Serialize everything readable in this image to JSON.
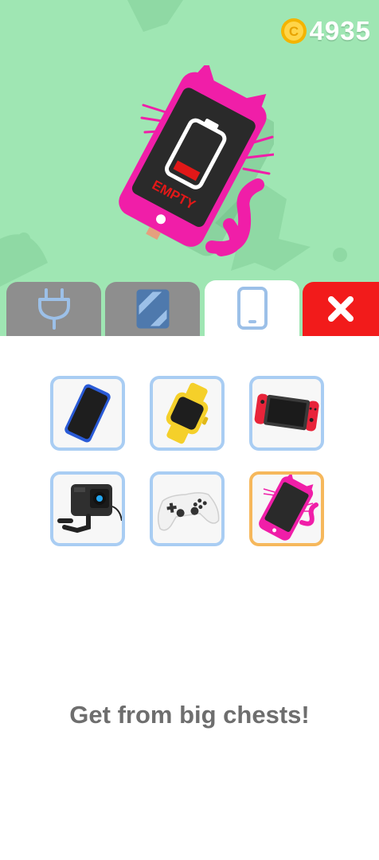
{
  "currency": {
    "amount": "4935",
    "icon": "coin-icon"
  },
  "preview": {
    "device": "cat-phone-case",
    "screen_label": "EMPTY"
  },
  "tabs": [
    {
      "name": "plug",
      "icon": "plug-icon",
      "active": false
    },
    {
      "name": "skin",
      "icon": "striped-card-icon",
      "active": false
    },
    {
      "name": "device",
      "icon": "phone-outline-icon",
      "active": true
    },
    {
      "name": "close",
      "icon": "close-icon"
    }
  ],
  "devices": [
    {
      "name": "smartphone-blue",
      "selected": false
    },
    {
      "name": "smartwatch-yellow",
      "selected": false
    },
    {
      "name": "handheld-console-red",
      "selected": false
    },
    {
      "name": "action-camera",
      "selected": false
    },
    {
      "name": "gamepad-white",
      "selected": false
    },
    {
      "name": "cat-phone-pink",
      "selected": true
    }
  ],
  "message": "Get from big chests!",
  "colors": {
    "background": "#9fe6b3",
    "case_pink": "#f01ea8",
    "close_red": "#f21b1b",
    "tab_gray": "#8e8e8e",
    "item_border": "#a9cdf3",
    "selected_border": "#f6b85c"
  }
}
